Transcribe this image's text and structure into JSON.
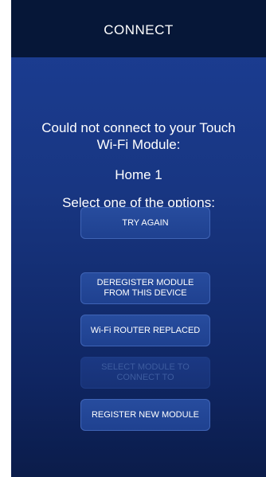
{
  "header": {
    "title": "CONNECT"
  },
  "message": {
    "line1": "Could not connect to your Touch",
    "line2": "Wi-Fi Module:",
    "module_name": "Home 1",
    "instruction": "Select one of the options:"
  },
  "buttons": {
    "try_again": "TRY AGAIN",
    "deregister": "DEREGISTER MODULE\nFROM THIS DEVICE",
    "router_replaced": "Wi-Fi ROUTER REPLACED",
    "select_module": "SELECT MODULE TO\nCONNECT TO",
    "register_new": "REGISTER NEW MODULE"
  }
}
